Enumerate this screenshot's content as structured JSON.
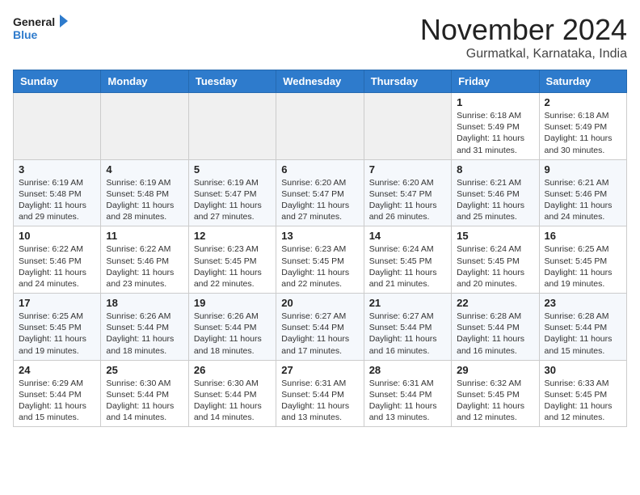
{
  "logo": {
    "line1": "General",
    "line2": "Blue"
  },
  "title": "November 2024",
  "location": "Gurmatkal, Karnataka, India",
  "weekdays": [
    "Sunday",
    "Monday",
    "Tuesday",
    "Wednesday",
    "Thursday",
    "Friday",
    "Saturday"
  ],
  "weeks": [
    [
      {
        "day": "",
        "info": ""
      },
      {
        "day": "",
        "info": ""
      },
      {
        "day": "",
        "info": ""
      },
      {
        "day": "",
        "info": ""
      },
      {
        "day": "",
        "info": ""
      },
      {
        "day": "1",
        "info": "Sunrise: 6:18 AM\nSunset: 5:49 PM\nDaylight: 11 hours and 31 minutes."
      },
      {
        "day": "2",
        "info": "Sunrise: 6:18 AM\nSunset: 5:49 PM\nDaylight: 11 hours and 30 minutes."
      }
    ],
    [
      {
        "day": "3",
        "info": "Sunrise: 6:19 AM\nSunset: 5:48 PM\nDaylight: 11 hours and 29 minutes."
      },
      {
        "day": "4",
        "info": "Sunrise: 6:19 AM\nSunset: 5:48 PM\nDaylight: 11 hours and 28 minutes."
      },
      {
        "day": "5",
        "info": "Sunrise: 6:19 AM\nSunset: 5:47 PM\nDaylight: 11 hours and 27 minutes."
      },
      {
        "day": "6",
        "info": "Sunrise: 6:20 AM\nSunset: 5:47 PM\nDaylight: 11 hours and 27 minutes."
      },
      {
        "day": "7",
        "info": "Sunrise: 6:20 AM\nSunset: 5:47 PM\nDaylight: 11 hours and 26 minutes."
      },
      {
        "day": "8",
        "info": "Sunrise: 6:21 AM\nSunset: 5:46 PM\nDaylight: 11 hours and 25 minutes."
      },
      {
        "day": "9",
        "info": "Sunrise: 6:21 AM\nSunset: 5:46 PM\nDaylight: 11 hours and 24 minutes."
      }
    ],
    [
      {
        "day": "10",
        "info": "Sunrise: 6:22 AM\nSunset: 5:46 PM\nDaylight: 11 hours and 24 minutes."
      },
      {
        "day": "11",
        "info": "Sunrise: 6:22 AM\nSunset: 5:46 PM\nDaylight: 11 hours and 23 minutes."
      },
      {
        "day": "12",
        "info": "Sunrise: 6:23 AM\nSunset: 5:45 PM\nDaylight: 11 hours and 22 minutes."
      },
      {
        "day": "13",
        "info": "Sunrise: 6:23 AM\nSunset: 5:45 PM\nDaylight: 11 hours and 22 minutes."
      },
      {
        "day": "14",
        "info": "Sunrise: 6:24 AM\nSunset: 5:45 PM\nDaylight: 11 hours and 21 minutes."
      },
      {
        "day": "15",
        "info": "Sunrise: 6:24 AM\nSunset: 5:45 PM\nDaylight: 11 hours and 20 minutes."
      },
      {
        "day": "16",
        "info": "Sunrise: 6:25 AM\nSunset: 5:45 PM\nDaylight: 11 hours and 19 minutes."
      }
    ],
    [
      {
        "day": "17",
        "info": "Sunrise: 6:25 AM\nSunset: 5:45 PM\nDaylight: 11 hours and 19 minutes."
      },
      {
        "day": "18",
        "info": "Sunrise: 6:26 AM\nSunset: 5:44 PM\nDaylight: 11 hours and 18 minutes."
      },
      {
        "day": "19",
        "info": "Sunrise: 6:26 AM\nSunset: 5:44 PM\nDaylight: 11 hours and 18 minutes."
      },
      {
        "day": "20",
        "info": "Sunrise: 6:27 AM\nSunset: 5:44 PM\nDaylight: 11 hours and 17 minutes."
      },
      {
        "day": "21",
        "info": "Sunrise: 6:27 AM\nSunset: 5:44 PM\nDaylight: 11 hours and 16 minutes."
      },
      {
        "day": "22",
        "info": "Sunrise: 6:28 AM\nSunset: 5:44 PM\nDaylight: 11 hours and 16 minutes."
      },
      {
        "day": "23",
        "info": "Sunrise: 6:28 AM\nSunset: 5:44 PM\nDaylight: 11 hours and 15 minutes."
      }
    ],
    [
      {
        "day": "24",
        "info": "Sunrise: 6:29 AM\nSunset: 5:44 PM\nDaylight: 11 hours and 15 minutes."
      },
      {
        "day": "25",
        "info": "Sunrise: 6:30 AM\nSunset: 5:44 PM\nDaylight: 11 hours and 14 minutes."
      },
      {
        "day": "26",
        "info": "Sunrise: 6:30 AM\nSunset: 5:44 PM\nDaylight: 11 hours and 14 minutes."
      },
      {
        "day": "27",
        "info": "Sunrise: 6:31 AM\nSunset: 5:44 PM\nDaylight: 11 hours and 13 minutes."
      },
      {
        "day": "28",
        "info": "Sunrise: 6:31 AM\nSunset: 5:44 PM\nDaylight: 11 hours and 13 minutes."
      },
      {
        "day": "29",
        "info": "Sunrise: 6:32 AM\nSunset: 5:45 PM\nDaylight: 11 hours and 12 minutes."
      },
      {
        "day": "30",
        "info": "Sunrise: 6:33 AM\nSunset: 5:45 PM\nDaylight: 11 hours and 12 minutes."
      }
    ]
  ]
}
